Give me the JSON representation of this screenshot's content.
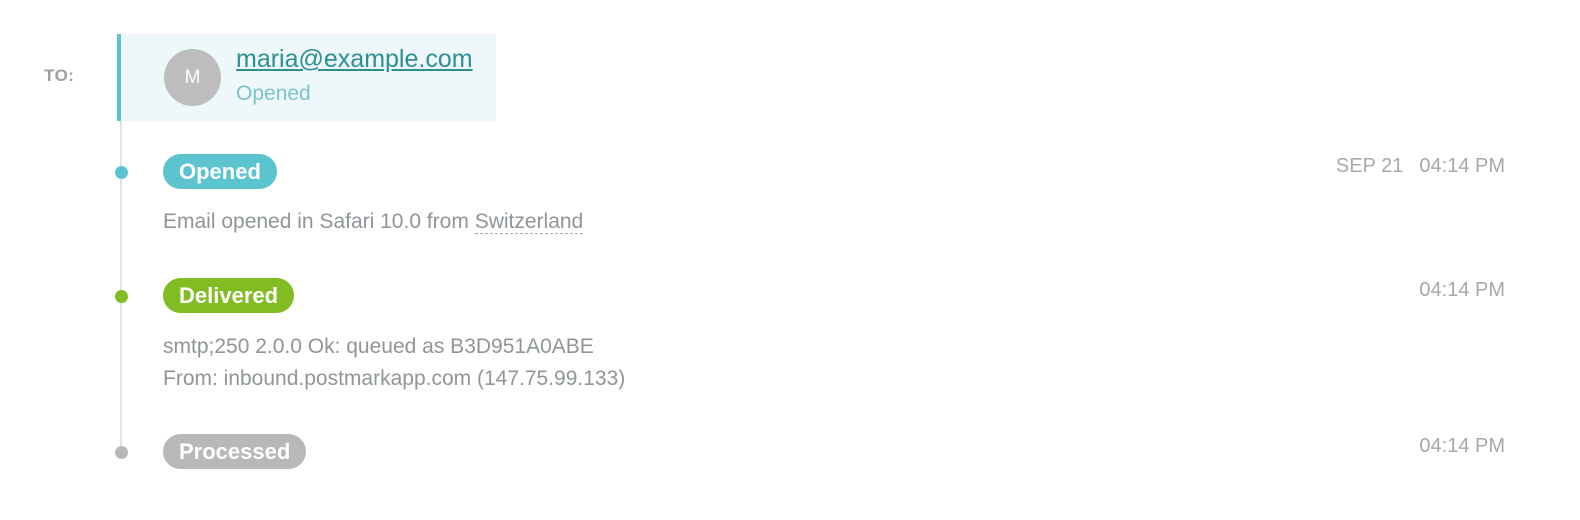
{
  "to_label": "TO:",
  "recipient": {
    "avatar_initial": "M",
    "email": "maria@example.com",
    "status": "Opened"
  },
  "events": [
    {
      "status": "Opened",
      "color": "#5bc4cf",
      "date": "SEP 21",
      "time": "04:14 PM",
      "detail_prefix": "Email opened in Safari 10.0 from",
      "location": "Switzerland"
    },
    {
      "status": "Delivered",
      "color": "#82bc23",
      "time": "04:14 PM",
      "detail_line1": "smtp;250 2.0.0 Ok: queued as B3D951A0ABE",
      "detail_line2": "From: inbound.postmarkapp.com (147.75.99.133)"
    },
    {
      "status": "Processed",
      "color": "#b8b8b8",
      "time": "04:14 PM"
    }
  ]
}
